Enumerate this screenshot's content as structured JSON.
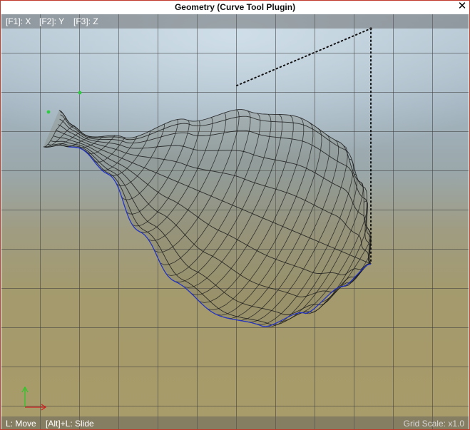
{
  "window": {
    "title": "Geometry (Curve Tool Plugin)",
    "close_glyph": "✕"
  },
  "viewport": {
    "axis_keys": [
      "[F1]: X",
      "[F2]: Y",
      "[F3]: Z"
    ],
    "hints": {
      "move": "L: Move",
      "slide": "[Alt]+L: Slide"
    },
    "grid_scale": "Grid Scale: x1.0"
  },
  "colors": {
    "frame": "#c0392b",
    "mesh": "#1a1a1a",
    "curve": "#2233cc",
    "control_point": "#2ecc40",
    "axis_y": "#22cc22",
    "axis_x": "#cc2222"
  },
  "icons": {
    "close": "close-icon",
    "axis": "axis-gizmo-icon"
  }
}
